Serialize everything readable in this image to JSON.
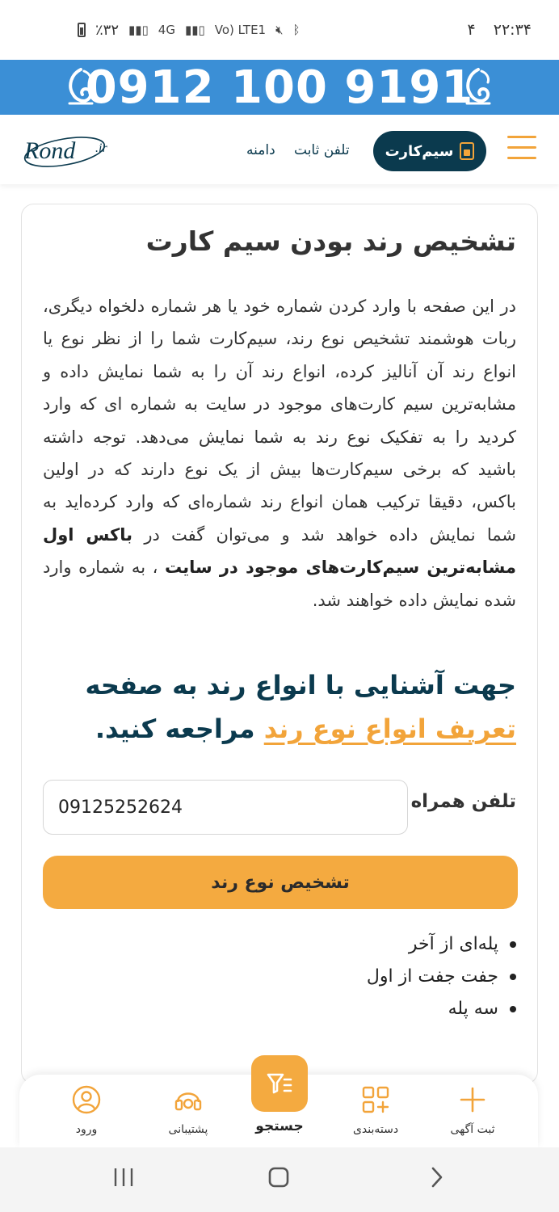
{
  "status_bar": {
    "time": "۲۲:۳۴",
    "notification_count": "۴",
    "battery": "٪۳۲",
    "network_4g": "4G",
    "volte": "Vo) LTE1"
  },
  "banner": {
    "phone_number": "0912 100 9191",
    "color": "#3b8fd6"
  },
  "header": {
    "sim_card_label": "سیم‌کارت",
    "landline_label": "تلفن ثابت",
    "domain_label": "دامنه",
    "logo_text": "Rond",
    "logo_suffix": ".ir"
  },
  "content": {
    "title": "تشخیص رند بودن سیم کارت",
    "intro_text": "در این صفحه با وارد کردن شماره خود یا هر شماره دلخواه دیگری، ربات هوشمند تشخیص نوع رند، سیم‌کارت شما را از نظر نوع یا انواع رند آن آنالیز کرده، انواع رند آن را به شما نمایش داده و مشابه‌ترین سیم کارت‌های موجود در سایت به شماره ای که وارد کردید را به تفکیک نوع رند به شما نمایش می‌دهد. توجه داشته باشید که برخی سیم‌کارت‌ها بیش از یک نوع دارند که در اولین باکس، دقیقا ترکیب همان انواع رند شماره‌ای که وارد کرده‌اید به شما نمایش داده خواهد شد و می‌توان گفت در",
    "intro_bold": "باکس اول مشابه‌ترین سیم‌کارت‌های موجود در سایت",
    "intro_end": "، به شماره وارد شده نمایش داده خواهند شد.",
    "guide_text_1": "جهت آشنایی با انواع رند به صفحه",
    "guide_link": "تعریف انواع نوع رند",
    "guide_text_2": "مراجعه کنید.",
    "phone_label": "تلفن همراه",
    "phone_value": "09125252624",
    "submit_label": "تشخیص نوع رند",
    "options": [
      "پله‌ای از آخر",
      "جفت جفت از اول",
      "سه پله"
    ]
  },
  "bottom_nav": {
    "login": "ورود",
    "support": "پشتیبانی",
    "search": "جستجو",
    "categories": "دسته‌بندی",
    "post_ad": "ثبت آگهی"
  },
  "colors": {
    "accent": "#f4aa40",
    "primary_dark": "#0b3a4e",
    "banner_blue": "#3b8fd6"
  }
}
